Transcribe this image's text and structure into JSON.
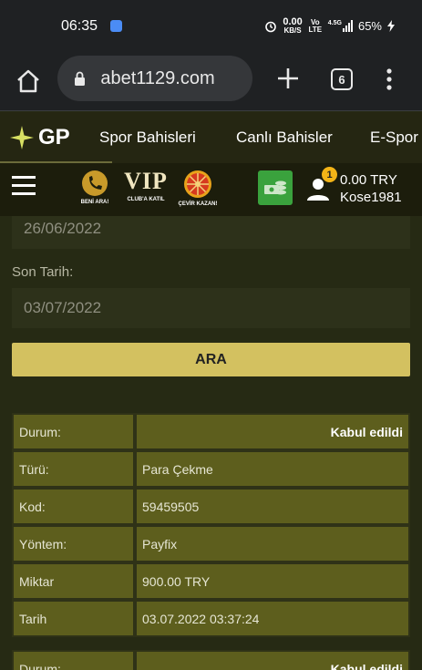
{
  "status_bar": {
    "time": "06:35",
    "net_speed": "0.00",
    "net_unit": "KB/S",
    "volte": "Vo LTE",
    "signal": "4.5G",
    "battery": "65%"
  },
  "browser": {
    "url": " abet1129.com",
    "tab_count": "6"
  },
  "site_nav": {
    "logo": "GP",
    "items": [
      "Spor Bahisleri",
      "Canlı Bahisler",
      "E-Spor"
    ]
  },
  "site_bar": {
    "promos": [
      {
        "label": "BENİ ARA!"
      },
      {
        "label": "CLUB'A KATIL",
        "title": "VIP"
      },
      {
        "label": "ÇEVİR KAZAN!"
      }
    ],
    "badge_count": "1",
    "balance": "0.00 TRY",
    "username": "Kose1981"
  },
  "form": {
    "start_date": "26/06/2022",
    "end_label": "Son Tarih:",
    "end_date": "03/07/2022",
    "search_button": "ARA"
  },
  "transactions": [
    {
      "rows": [
        {
          "key": "Durum:",
          "value": "Kabul edildi",
          "bold": true
        },
        {
          "key": "Türü:",
          "value": "Para Çekme"
        },
        {
          "key": "Kod:",
          "value": "59459505"
        },
        {
          "key": "Yöntem:",
          "value": "Payfix"
        },
        {
          "key": "Miktar",
          "value": "900.00 TRY"
        },
        {
          "key": "Tarih",
          "value": "03.07.2022 03:37:24"
        }
      ]
    },
    {
      "rows": [
        {
          "key": "Durum:",
          "value": "Kabul edildi",
          "bold": true
        }
      ]
    }
  ],
  "colors": {
    "accent": "#d3c160",
    "row_bg": "#5d5e1d",
    "badge": "#f3b417",
    "money_icon": "#3aa23d"
  }
}
